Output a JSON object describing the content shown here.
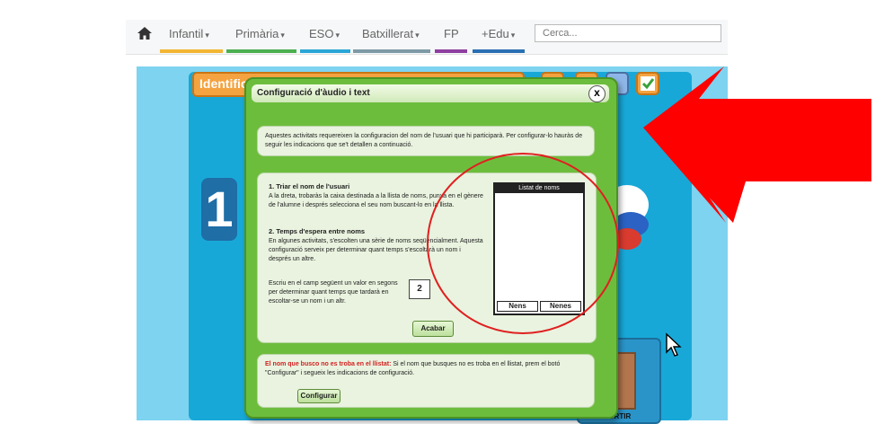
{
  "nav": {
    "items": [
      {
        "label": "Infantil",
        "caret": "▾",
        "color": "#f2b632"
      },
      {
        "label": "Primària",
        "caret": "▾",
        "color": "#4caf50"
      },
      {
        "label": "ESO",
        "caret": "▾",
        "color": "#2aa6d6"
      },
      {
        "label": "Batxillerat",
        "caret": "▾",
        "color": "#7e9aa6"
      },
      {
        "label": "FP",
        "caret": "",
        "color": "#8e3fa0"
      },
      {
        "label": "+Edu",
        "caret": "▾",
        "color": "#2a6fb3"
      }
    ],
    "search_placeholder": "Cerca...",
    "home_icon": "home-icon"
  },
  "game": {
    "title": "Identifica el teu nom",
    "exit_label": "SORTIR",
    "big_number": "1"
  },
  "dialog": {
    "title": "Configuració d'àudio i text",
    "close": "x",
    "intro": "Aquestes activitats requereixen la configuracion del nom de l'usuari que hi participarà. Per configurar-lo hauràs de seguir les indicacions que se't detallen a continuació.",
    "step1_title": "1. Triar el nom de l'usuari",
    "step1_text": "A la dreta, trobaràs la caixa destinada a la llista de noms, punxa en el gènere de l'alumne i després selecciona el seu nom buscant-lo en la llista.",
    "step2_title": "2. Temps d'espera entre noms",
    "step2_text": "En algunes activitats, s'escolten una sèrie de noms seqüencialment. Aquesta configuració serveix per determinar quant temps s'escoltarà un nom i després un altre.",
    "step2_field_text": "Escriu en el camp següent un valor en segons per determinar quant temps que tardarà en escoltar-se un nom i un altr.",
    "wait_value": "2",
    "finish_label": "Acabar",
    "list_title": "Listat de noms",
    "boys_label": "Nens",
    "girls_label": "Nenes",
    "not_found_title": "El nom que busco no es troba en el llistat:",
    "not_found_text": " Si el nom que busques no es troba en el llistat, prem el botó \"Configurar\" i segueix les indicacions de configuració.",
    "config_label": "Configurar"
  },
  "colors": {
    "annotation_red": "#ff0000",
    "dialog_green": "#6dbd3d",
    "game_blue": "#18a8d8"
  }
}
